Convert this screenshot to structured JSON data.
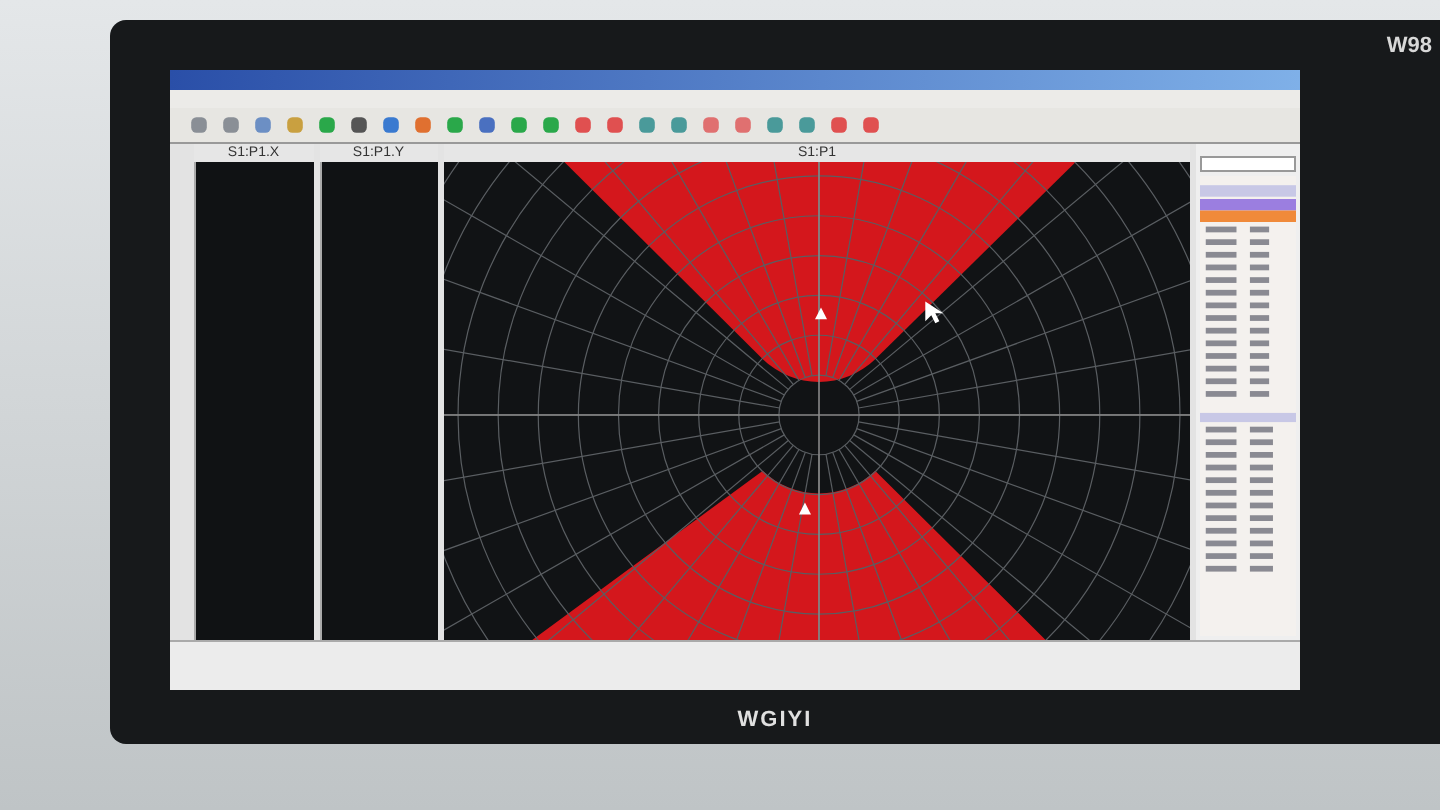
{
  "monitor": {
    "brand": "WGIYI",
    "model": "W98"
  },
  "panels": [
    {
      "title": "S1:P1.X"
    },
    {
      "title": "S1:P1.Y"
    }
  ],
  "plot": {
    "title": "S1:P1"
  }
}
